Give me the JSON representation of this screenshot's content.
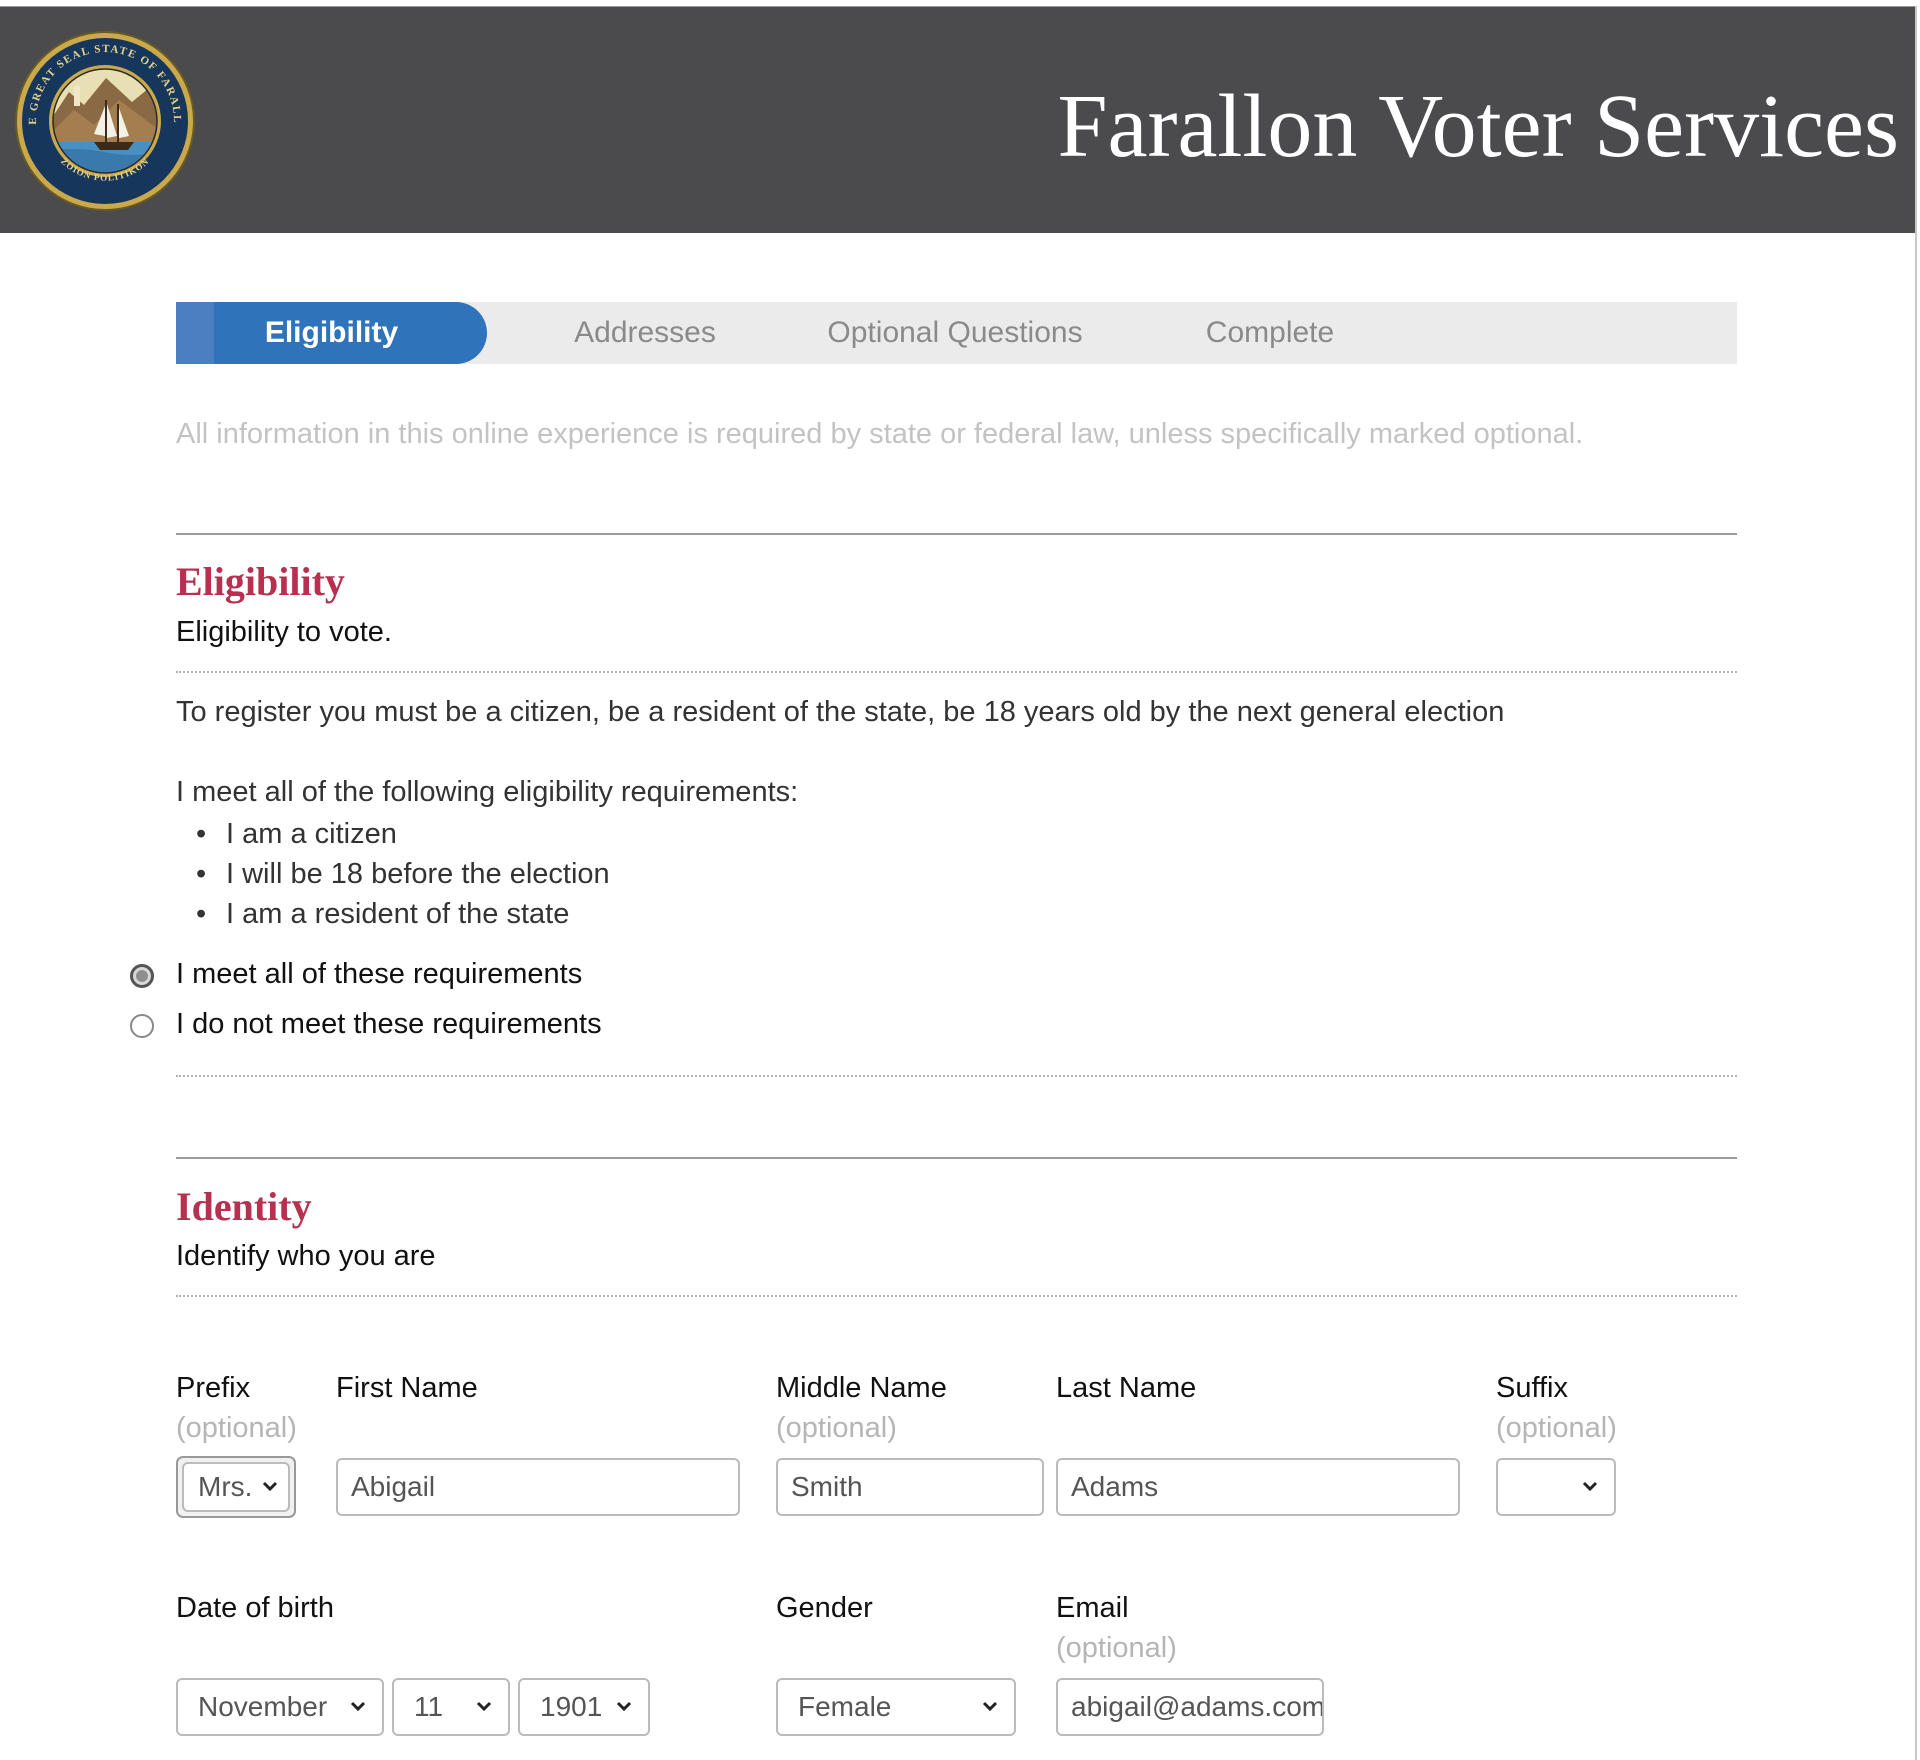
{
  "header": {
    "title": "Farallon Voter Services",
    "seal_top_text": "THE GREAT SEAL STATE OF FARALLON",
    "seal_bottom_text": "ZOION POLITIKON"
  },
  "steps": [
    {
      "label": "Eligibility",
      "active": true
    },
    {
      "label": "Addresses",
      "active": false
    },
    {
      "label": "Optional Questions",
      "active": false
    },
    {
      "label": "Complete",
      "active": false
    }
  ],
  "note": "All information in this online experience is required by state or federal law, unless specifically marked optional.",
  "eligibility": {
    "title": "Eligibility",
    "subtitle": "Eligibility to vote.",
    "description": "To register you must be a citizen, be a resident of the state, be 18 years old by the next general election",
    "list_intro": "I meet all of the following eligibility requirements:",
    "requirements": [
      "I am a citizen",
      "I will be 18 before the election",
      "I am a resident of the state"
    ],
    "options": [
      {
        "label": "I meet all of these requirements",
        "checked": true
      },
      {
        "label": "I do not meet these requirements",
        "checked": false
      }
    ]
  },
  "identity": {
    "title": "Identity",
    "subtitle": "Identify who you are",
    "optional_label": "(optional)",
    "prefix": {
      "label": "Prefix",
      "value": "Mrs."
    },
    "first_name": {
      "label": "First Name",
      "value": "Abigail"
    },
    "middle_name": {
      "label": "Middle Name",
      "value": "Smith"
    },
    "last_name": {
      "label": "Last Name",
      "value": "Adams"
    },
    "suffix": {
      "label": "Suffix",
      "value": ""
    },
    "dob": {
      "label": "Date of birth",
      "month": "November",
      "day": "11",
      "year": "1901"
    },
    "gender": {
      "label": "Gender",
      "value": "Female"
    },
    "email": {
      "label": "Email",
      "value": "abigail@adams.com"
    }
  },
  "colors": {
    "header_bg": "#4b4a4d",
    "step_active": "#2f74bb",
    "section_title": "#b8304f",
    "note_text": "#c3c3c3"
  }
}
